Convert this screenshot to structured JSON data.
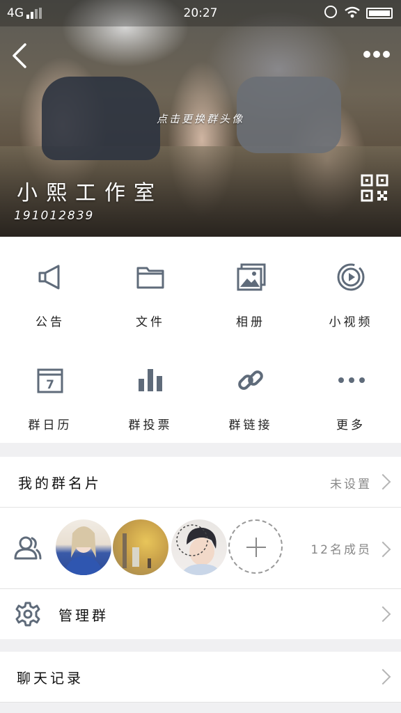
{
  "status_bar": {
    "network": "4G",
    "time": "20:27"
  },
  "header": {
    "change_avatar_hint": "点击更换群头像",
    "group_name": "小熙工作室",
    "group_id": "191012839"
  },
  "features": [
    {
      "label": "公告",
      "icon": "megaphone-icon"
    },
    {
      "label": "文件",
      "icon": "folder-icon"
    },
    {
      "label": "相册",
      "icon": "album-icon"
    },
    {
      "label": "小视频",
      "icon": "video-icon"
    },
    {
      "label": "群日历",
      "icon": "calendar-icon"
    },
    {
      "label": "群投票",
      "icon": "vote-icon"
    },
    {
      "label": "群链接",
      "icon": "link-icon"
    },
    {
      "label": "更多",
      "icon": "more-dots-icon"
    }
  ],
  "calendar_day": "7",
  "card": {
    "label": "我的群名片",
    "value": "未设置"
  },
  "members": {
    "count_label": "12名成员"
  },
  "manage": {
    "label": "管理群"
  },
  "chat_history": {
    "label": "聊天记录"
  },
  "colors": {
    "icon_gray": "#5f6b7a",
    "chevron": "#b5b5b5"
  }
}
